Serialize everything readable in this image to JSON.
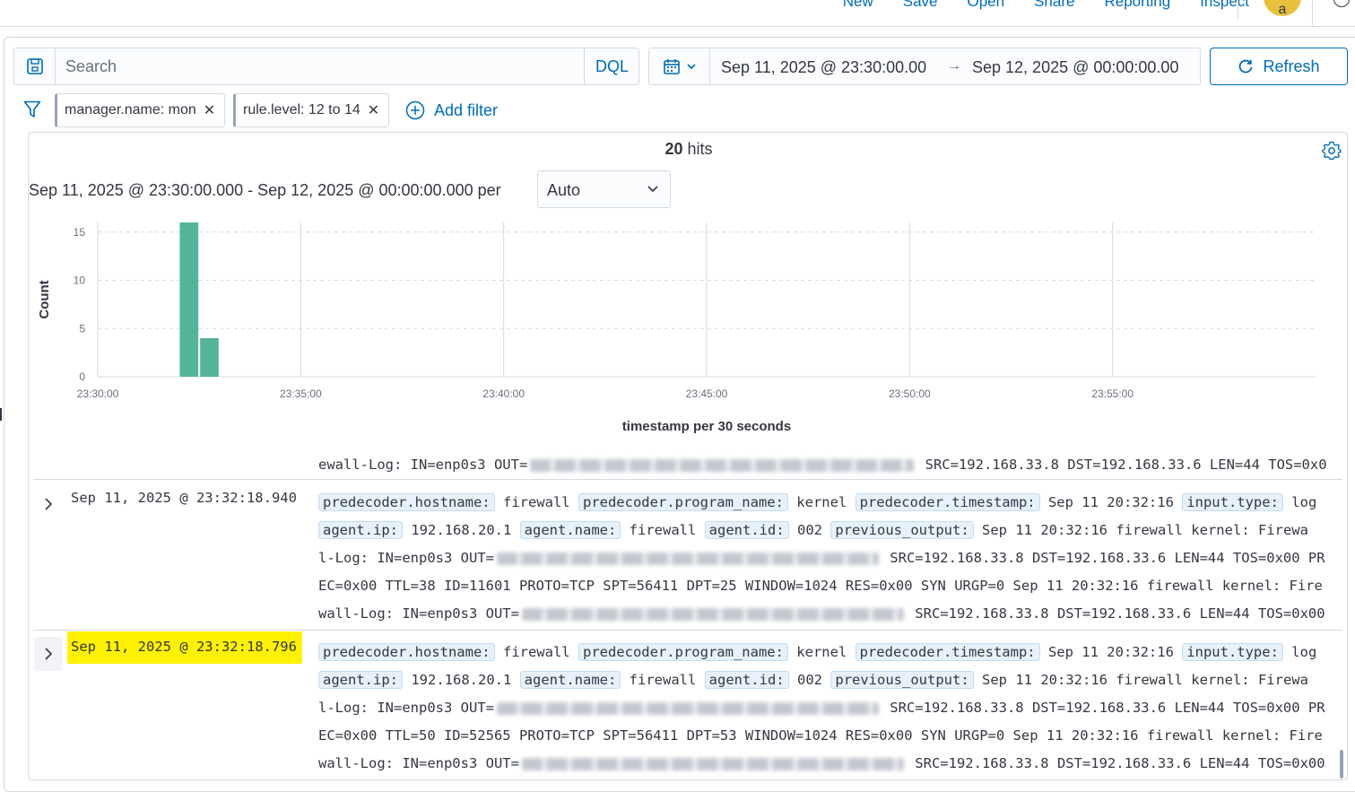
{
  "topnav": {
    "links": [
      "New",
      "Save",
      "Open",
      "Share",
      "Reporting",
      "Inspect"
    ],
    "avatar_initial": "a"
  },
  "query": {
    "placeholder": "Search",
    "language": "DQL"
  },
  "date_range": {
    "start": "Sep 11, 2025 @ 23:30:00.00",
    "end": "Sep 12, 2025 @ 00:00:00.00",
    "refresh_label": "Refresh"
  },
  "filters": {
    "pills": [
      "manager.name: mon",
      "rule.level: 12 to 14"
    ],
    "add_label": "Add filter"
  },
  "histogram": {
    "hits_count": "20",
    "hits_label": " hits",
    "interval_text": "Sep 11, 2025 @ 23:30:00.000 - Sep 12, 2025 @ 00:00:00.000 per",
    "interval_select": "Auto"
  },
  "chart_data": {
    "type": "bar",
    "x": [
      "23:32:00",
      "23:32:30"
    ],
    "values": [
      16,
      4
    ],
    "xlabel": "timestamp per 30 seconds",
    "ylabel": "Count",
    "ylim": [
      0,
      16
    ],
    "yticks": [
      0,
      5,
      10,
      15
    ],
    "xticks": [
      "23:30:00",
      "23:35:00",
      "23:40:00",
      "23:45:00",
      "23:50:00",
      "23:55:00"
    ],
    "bar_color": "#54b399",
    "grid": true
  },
  "documents": {
    "partial_tail": [
      "ewall-Log: IN=enp0s3 OUT=",
      " SRC=192.168.33.8 DST=192.168.33.6 LEN=44 TOS=0x0"
    ],
    "rows": [
      {
        "timestamp": "Sep 11, 2025 @ 23:32:18.940",
        "hostname_key": "predecoder.hostname:",
        "hostname": "firewall",
        "program_key": "predecoder.program_name:",
        "program": "kernel",
        "pts_key": "predecoder.timestamp:",
        "pts": "Sep 11 20:32:16",
        "itype_key": "input.type:",
        "itype": "log",
        "aip_key": "agent.ip:",
        "aip": "192.168.20.1",
        "aname_key": "agent.name:",
        "aname": "firewall",
        "aid_key": "agent.id:",
        "aid": "002",
        "prev_key": "previous_output:",
        "prev_a": "Sep 11 20:32:16 firewall kernel: Firewa",
        "l3a": "l-Log: IN=enp0s3 OUT=",
        "l3b": " SRC=192.168.33.8 DST=192.168.33.6 LEN=44 TOS=0x00 PR",
        "l4": "EC=0x00 TTL=38 ID=11601 PROTO=TCP SPT=56411 DPT=25 WINDOW=1024 RES=0x00 SYN URGP=0 Sep 11 20:32:16 firewall kernel: Fire",
        "l5a": "wall-Log: IN=enp0s3 OUT=",
        "l5b": " SRC=192.168.33.8 DST=192.168.33.6 LEN=44 TOS=0x00"
      },
      {
        "timestamp": "Sep 11, 2025 @ 23:32:18.796",
        "hostname_key": "predecoder.hostname:",
        "hostname": "firewall",
        "program_key": "predecoder.program_name:",
        "program": "kernel",
        "pts_key": "predecoder.timestamp:",
        "pts": "Sep 11 20:32:16",
        "itype_key": "input.type:",
        "itype": "log",
        "aip_key": "agent.ip:",
        "aip": "192.168.20.1",
        "aname_key": "agent.name:",
        "aname": "firewall",
        "aid_key": "agent.id:",
        "aid": "002",
        "prev_key": "previous_output:",
        "prev_a": "Sep 11 20:32:16 firewall kernel: Firewa",
        "l3a": "l-Log: IN=enp0s3 OUT=",
        "l3b": " SRC=192.168.33.8 DST=192.168.33.6 LEN=44 TOS=0x00 PR",
        "l4": "EC=0x00 TTL=50 ID=52565 PROTO=TCP SPT=56411 DPT=53 WINDOW=1024 RES=0x00 SYN URGP=0 Sep 11 20:32:16 firewall kernel: Fire",
        "l5a": "wall-Log: IN=enp0s3 OUT=",
        "l5b": " SRC=192.168.33.8 DST=192.168.33.6 LEN=44 TOS=0x00"
      }
    ]
  },
  "colors": {
    "link": "#006bb4",
    "highlight": "#fff200",
    "avatar": "#e7c13e"
  }
}
